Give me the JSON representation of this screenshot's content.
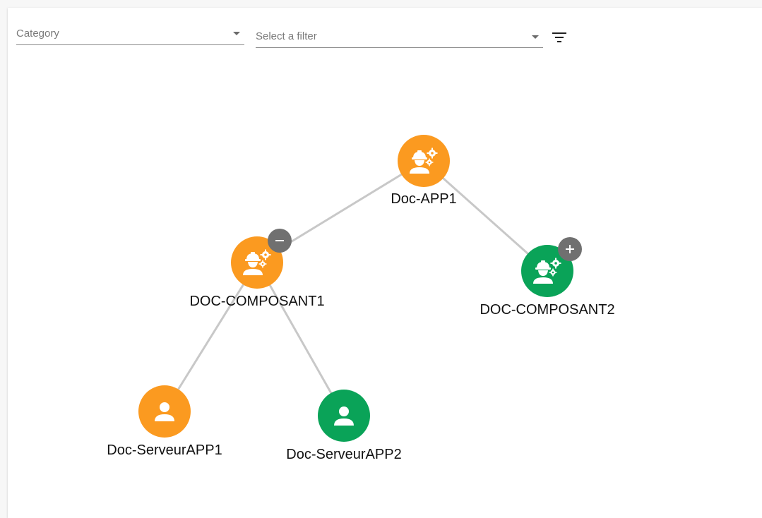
{
  "toolbar": {
    "category_placeholder": "Category",
    "filter_placeholder": "Select a filter",
    "filter_icon": "filter-list-icon"
  },
  "colors": {
    "orange": "#fb9a20",
    "green": "#0aa358",
    "edge": "#c8c8c8",
    "toggle": "#707070"
  },
  "nodes": [
    {
      "id": "doc-app1",
      "label": "Doc-APP1",
      "color": "orange",
      "icon": "worker-gears-icon",
      "toggle": null
    },
    {
      "id": "doc-composant1",
      "label": "DOC-COMPOSANT1",
      "color": "orange",
      "icon": "worker-gears-icon",
      "toggle": "collapse"
    },
    {
      "id": "doc-composant2",
      "label": "DOC-COMPOSANT2",
      "color": "green",
      "icon": "worker-gears-icon",
      "toggle": "expand"
    },
    {
      "id": "doc-serveurapp1",
      "label": "Doc-ServeurAPP1",
      "color": "orange",
      "icon": "person-icon",
      "toggle": null
    },
    {
      "id": "doc-serveurapp2",
      "label": "Doc-ServeurAPP2",
      "color": "green",
      "icon": "person-icon",
      "toggle": null
    }
  ],
  "edges": [
    {
      "from": "doc-app1",
      "to": "doc-composant1"
    },
    {
      "from": "doc-app1",
      "to": "doc-composant2"
    },
    {
      "from": "doc-composant1",
      "to": "doc-serveurapp1"
    },
    {
      "from": "doc-composant1",
      "to": "doc-serveurapp2"
    }
  ]
}
